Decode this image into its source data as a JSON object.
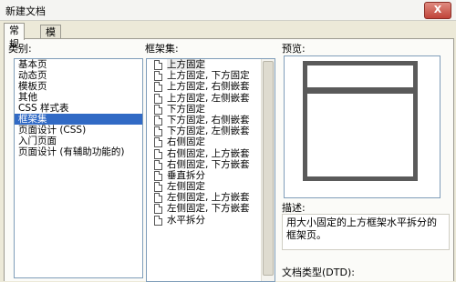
{
  "window": {
    "title": "新建文档",
    "close_label": "X"
  },
  "tabs": [
    {
      "label": "常规",
      "active": true
    },
    {
      "label": "模板",
      "active": false
    }
  ],
  "category": {
    "label": "类别:",
    "items": [
      "基本页",
      "动态页",
      "模板页",
      "其他",
      "CSS 样式表",
      "框架集",
      "页面设计 (CSS)",
      "入门页面",
      "页面设计 (有辅助功能的)"
    ],
    "selected_index": 5
  },
  "frameset": {
    "label": "框架集:",
    "items": [
      "上方固定",
      "上方固定, 下方固定",
      "上方固定, 右侧嵌套",
      "上方固定, 左侧嵌套",
      "下方固定",
      "下方固定, 右侧嵌套",
      "下方固定, 左侧嵌套",
      "右侧固定",
      "右侧固定, 上方嵌套",
      "右侧固定, 下方嵌套",
      "垂直拆分",
      "左侧固定",
      "左侧固定, 上方嵌套",
      "左侧固定, 下方嵌套",
      "水平拆分"
    ],
    "selected_index": 0
  },
  "preview": {
    "label": "预览:"
  },
  "description": {
    "label": "描述:",
    "text": "用大小固定的上方框架水平拆分的框架页。"
  },
  "doctype": {
    "label": "文档类型(DTD):"
  }
}
